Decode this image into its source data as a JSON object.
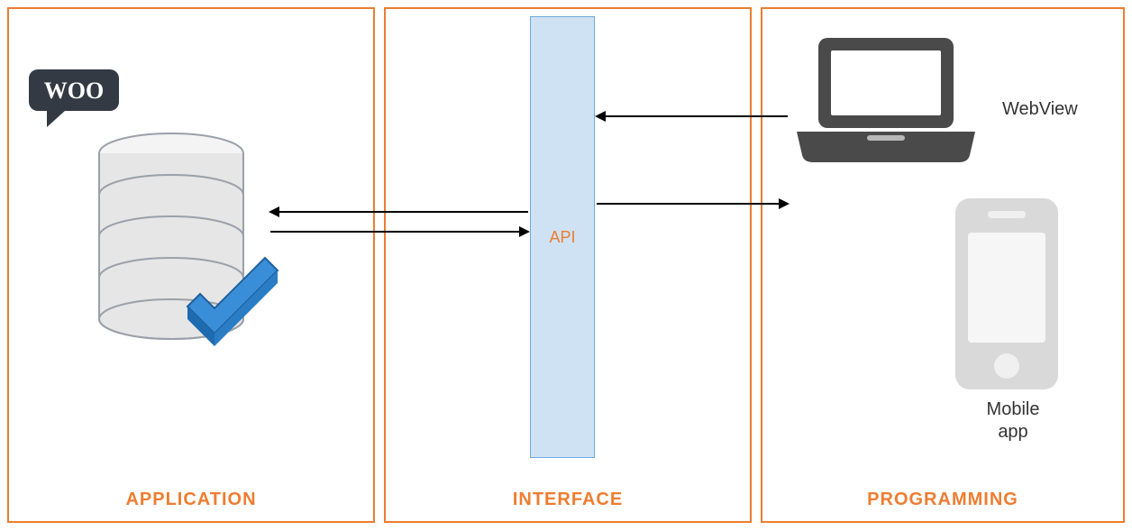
{
  "panels": {
    "left": {
      "label": "APPLICATION"
    },
    "middle": {
      "label": "INTERFACE",
      "api_label": "API"
    },
    "right": {
      "label": "PROGRAMMING"
    }
  },
  "graphics": {
    "woo_text": "WOO",
    "webview_label": "WebView",
    "mobile_label_line1": "Mobile",
    "mobile_label_line2": "app"
  }
}
